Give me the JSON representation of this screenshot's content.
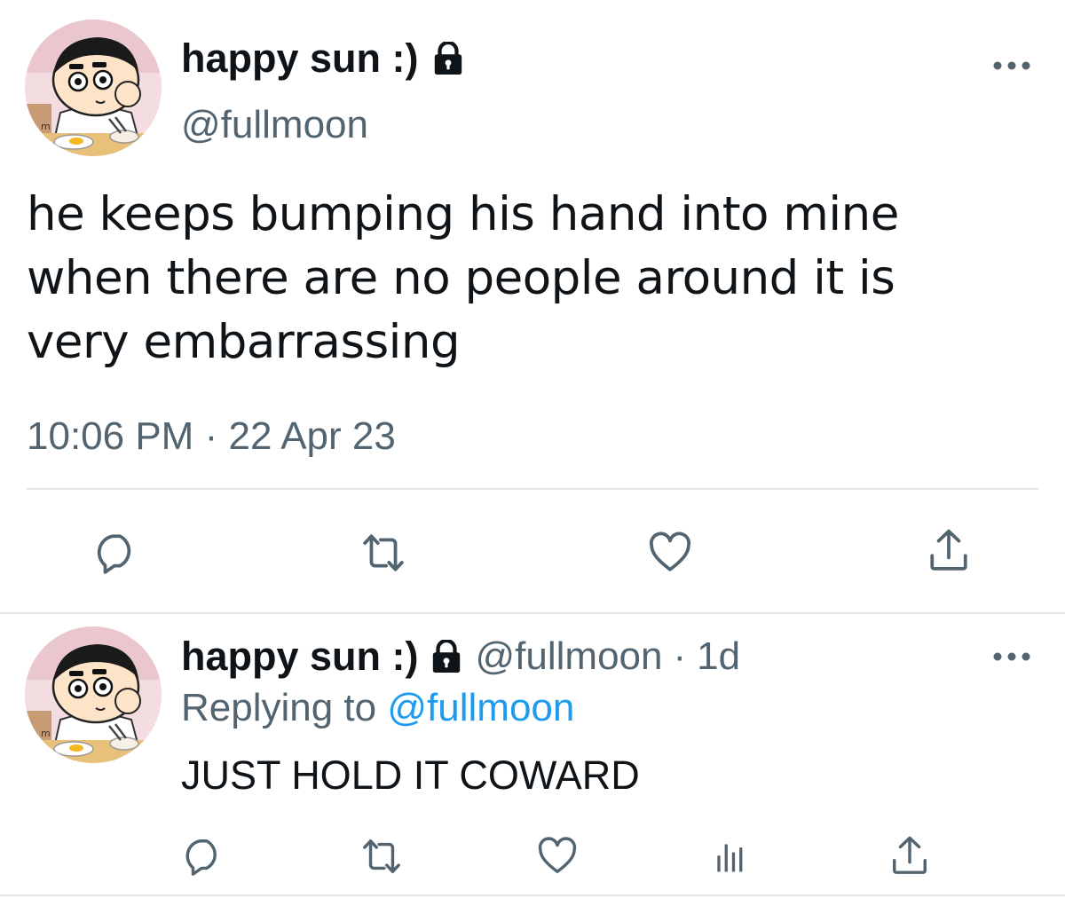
{
  "main_tweet": {
    "display_name": "happy sun :)",
    "handle": "@fullmoon",
    "text": "he keeps bumping his hand into mine\nwhen there are no people around it is\nvery embarrassing",
    "time": "10:06 PM",
    "separator": "·",
    "date": "22 Apr 23",
    "actions": {
      "reply_icon": "reply-bubble-icon",
      "retweet_icon": "retweet-icon",
      "like_icon": "heart-icon",
      "share_icon": "share-upload-icon"
    }
  },
  "reply_tweet": {
    "display_name": "happy sun :)",
    "handle": "@fullmoon",
    "separator": "·",
    "age": "1d",
    "replying_label": "Replying to",
    "replying_to": "@fullmoon",
    "text": "JUST HOLD IT COWARD",
    "actions": {
      "reply_icon": "reply-bubble-icon",
      "retweet_icon": "retweet-icon",
      "like_icon": "heart-icon",
      "analytics_icon": "analytics-icon",
      "share_icon": "share-upload-icon"
    }
  },
  "colors": {
    "text": "#0f1419",
    "secondary": "#536471",
    "link": "#1d9bf0",
    "divider": "#e1e6ea"
  },
  "icons": {
    "lock": "lock-icon",
    "more": "more-horizontal-icon",
    "avatar": "avatar"
  }
}
